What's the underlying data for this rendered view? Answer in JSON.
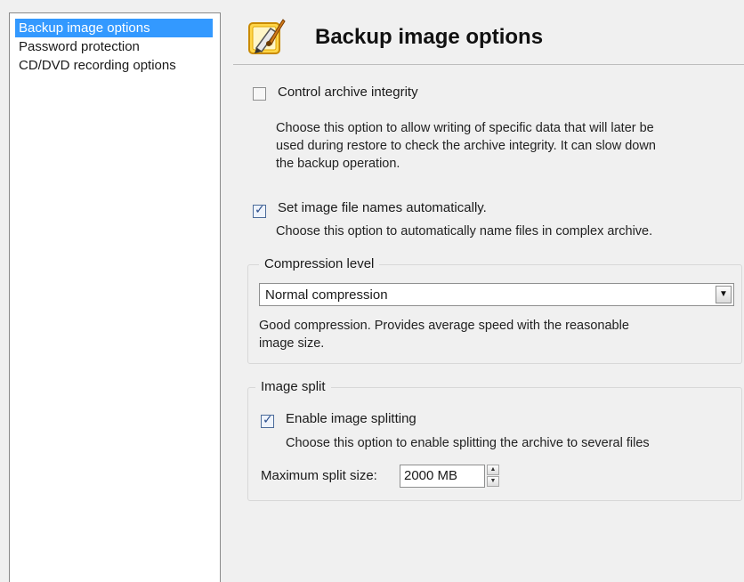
{
  "sidebar": {
    "items": [
      {
        "label": "Backup image options"
      },
      {
        "label": "Password protection"
      },
      {
        "label": "CD/DVD recording options"
      }
    ]
  },
  "header": {
    "title": "Backup image options",
    "icon": "pen-brush-icon"
  },
  "options": {
    "control_integrity": {
      "label": "Control archive integrity",
      "checked": false,
      "desc_line1": "Choose this option to allow writing of specific data that will later be",
      "desc_line2": "used during restore to check the archive integrity. It can slow down",
      "desc_line3": "the backup operation."
    },
    "auto_names": {
      "label": "Set image file names automatically.",
      "checked": true,
      "desc": "Choose this option to automatically name files in complex archive."
    }
  },
  "compression": {
    "title": "Compression level",
    "selected": "Normal compression",
    "desc_line1": "Good compression. Provides average speed with the reasonable",
    "desc_line2": "image size."
  },
  "split": {
    "title": "Image split",
    "enable_label": "Enable image splitting",
    "enabled": true,
    "desc": "Choose this option to enable splitting the archive to several files",
    "max_label": "Maximum split size:",
    "max_value": "2000 MB"
  },
  "colors": {
    "selection": "#3399ff",
    "background": "#f0f0f0"
  }
}
